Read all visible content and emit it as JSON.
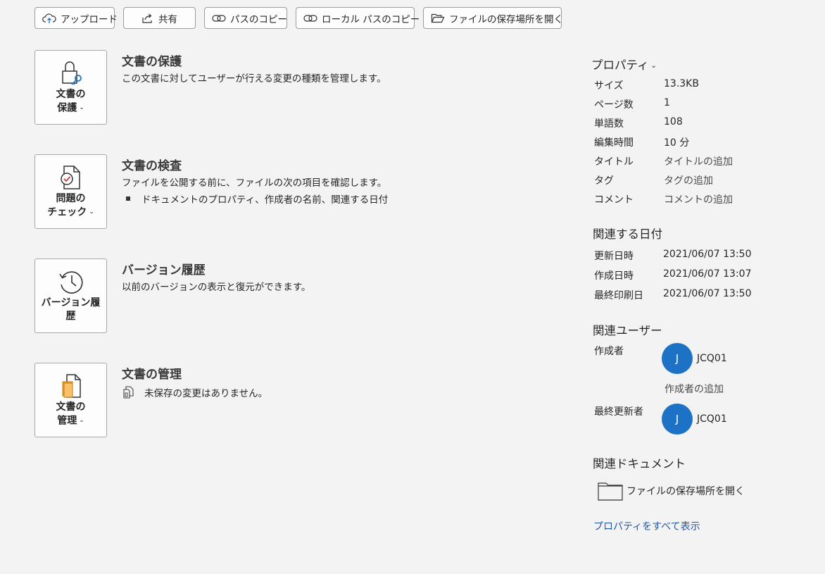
{
  "toolbar": {
    "upload": "アップロード",
    "share": "共有",
    "copy_path": "パスのコピー",
    "copy_local_path": "ローカル パスのコピー",
    "open_location": "ファイルの保存場所を開く"
  },
  "sections": {
    "protect": {
      "button_line1": "文書の",
      "button_line2": "保護",
      "title": "文書の保護",
      "description": "この文書に対してユーザーが行える変更の種類を管理します。"
    },
    "inspect": {
      "button_line1": "問題の",
      "button_line2": "チェック",
      "title": "文書の検査",
      "description": "ファイルを公開する前に、ファイルの次の項目を確認します。",
      "bullet": "ドキュメントのプロパティ、作成者の名前、関連する日付"
    },
    "versions": {
      "button_line1": "バージョン履",
      "button_line2": "歴",
      "title": "バージョン履歴",
      "description": "以前のバージョンの表示と復元ができます。"
    },
    "manage": {
      "button_line1": "文書の",
      "button_line2": "管理",
      "title": "文書の管理",
      "note": "未保存の変更はありません。"
    }
  },
  "properties": {
    "header": "プロパティ",
    "rows": [
      {
        "key": "サイズ",
        "value": "13.3KB"
      },
      {
        "key": "ページ数",
        "value": "1"
      },
      {
        "key": "単語数",
        "value": "108"
      },
      {
        "key": "編集時間",
        "value": "10 分"
      },
      {
        "key": "タイトル",
        "value": "タイトルの追加"
      },
      {
        "key": "タグ",
        "value": "タグの追加"
      },
      {
        "key": "コメント",
        "value": "コメントの追加"
      }
    ]
  },
  "dates": {
    "header": "関連する日付",
    "rows": [
      {
        "key": "更新日時",
        "value": "2021/06/07 13:50"
      },
      {
        "key": "作成日時",
        "value": "2021/06/07 13:07"
      },
      {
        "key": "最終印刷日",
        "value": "2021/06/07 13:50"
      }
    ]
  },
  "people": {
    "header": "関連ユーザー",
    "author_label": "作成者",
    "author_initial": "J",
    "author_name": "JCQ01",
    "add_author": "作成者の追加",
    "modifier_label": "最終更新者",
    "modifier_initial": "J",
    "modifier_name": "JCQ01"
  },
  "documents": {
    "header": "関連ドキュメント",
    "open_location": "ファイルの保存場所を開く"
  },
  "show_all_properties": "プロパティをすべて表示",
  "colors": {
    "background": "#f3f3f3",
    "avatar": "#1d72c6",
    "link": "#1e58a8",
    "accent_orange": "#f0a030"
  }
}
